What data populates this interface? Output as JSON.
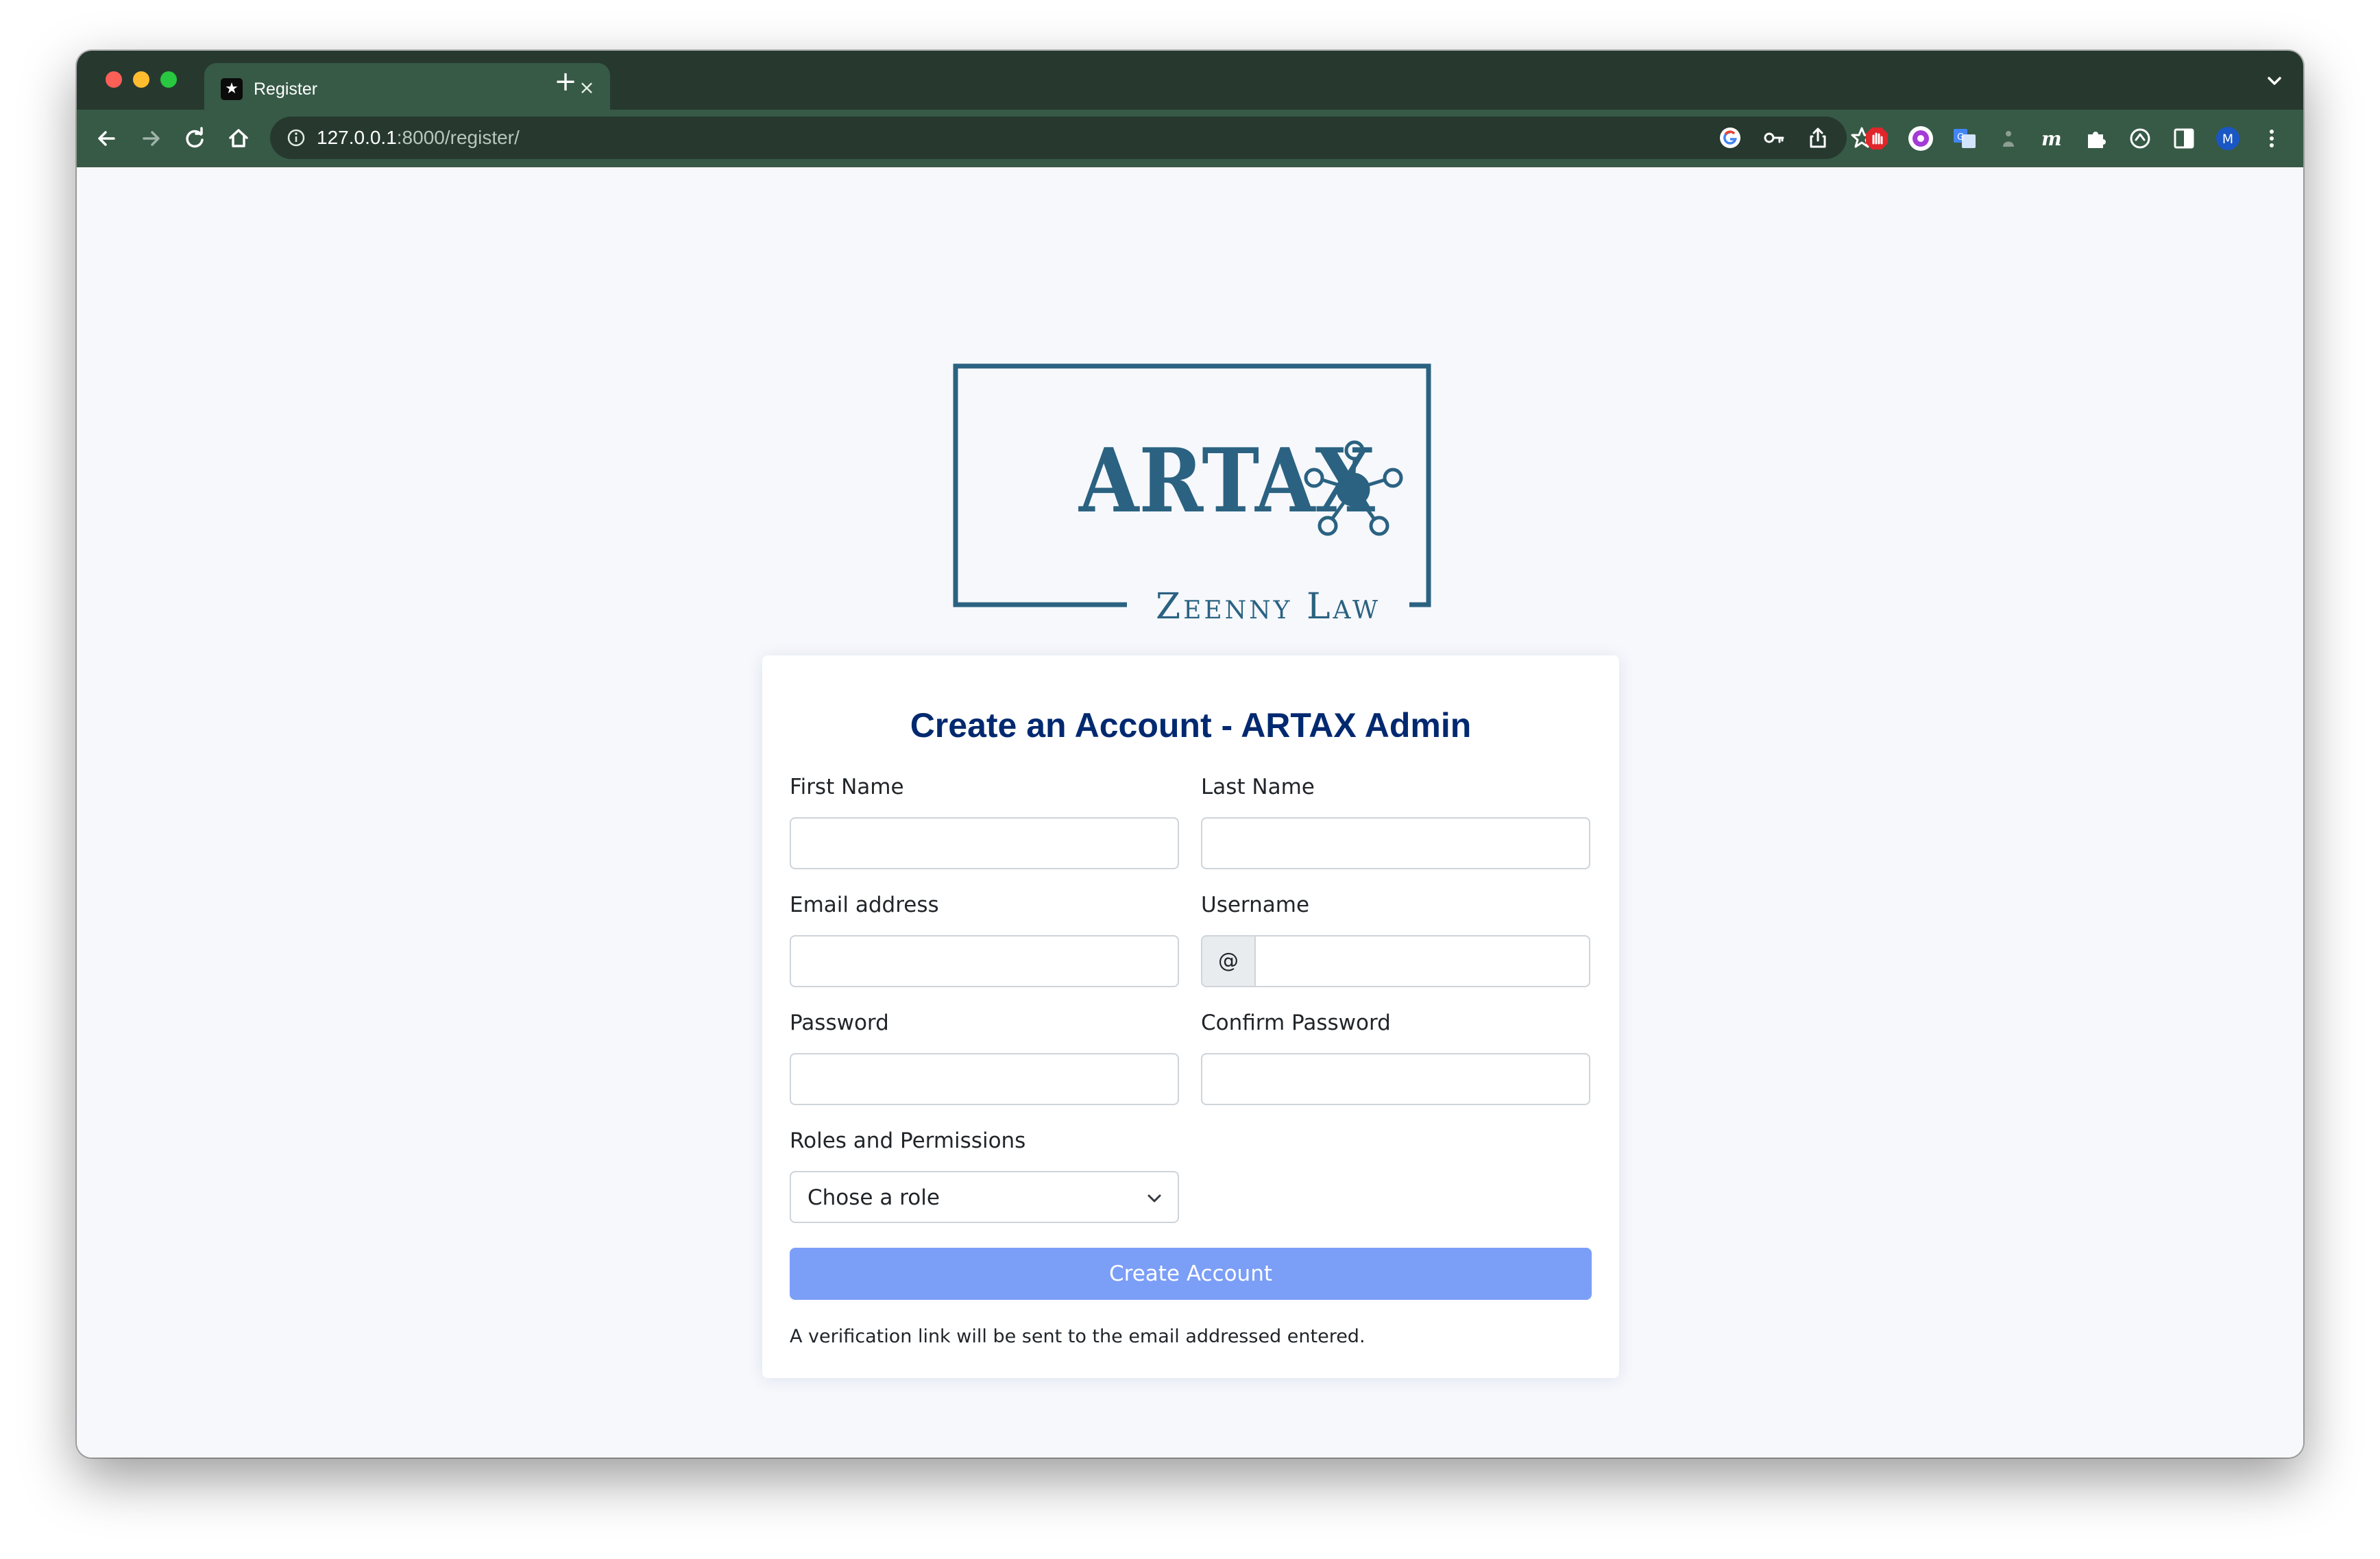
{
  "browser": {
    "tab": {
      "title": "Register",
      "close_icon": "×"
    },
    "new_tab_icon": "+",
    "url": {
      "host": "127.0.0.1",
      "rest": ":8000/register/"
    },
    "profile_initial": "M"
  },
  "logo": {
    "word": "ARTAX",
    "subtitle": "Zeenny Law",
    "color": "#2b6281"
  },
  "form": {
    "title": "Create an Account - ARTAX Admin",
    "first_name_label": "First Name",
    "last_name_label": "Last Name",
    "email_label": "Email address",
    "username_label": "Username",
    "username_prefix": "@",
    "password_label": "Password",
    "confirm_password_label": "Confirm Password",
    "role_label": "Roles and Permissions",
    "role_selected": "Chose a role",
    "submit_label": "Create Account",
    "note": "A verification link will be sent to the email addressed entered."
  },
  "colors": {
    "title": "#012970",
    "button": "#7b9ef7",
    "tabstrip": "#27392f",
    "toolbar": "#375a47",
    "page_bg": "#f6f8fc"
  }
}
